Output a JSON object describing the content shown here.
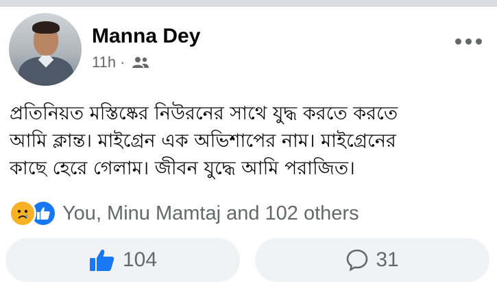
{
  "post": {
    "author": "Manna Dey",
    "time": "11h",
    "separator": "·",
    "audience_icon": "friends-icon",
    "menu_icon": "more-options-icon",
    "text_lines": [
      "প্রতিনিয়ত মস্তিষ্কের নিউরনের সাথে যুদ্ধ  করতে করতে",
      "আমি ক্লান্ত। মাইগ্রেন এক অভিশাপের নাম। মাইগ্রেনের",
      "কাছে হেরে গেলাম। জীবন যুদ্ধে আমি পরাজিত।"
    ]
  },
  "reactions": {
    "icons": [
      "sad-reaction-icon",
      "like-reaction-icon"
    ],
    "summary": "You, Minu Mamtaj and 102 others"
  },
  "actions": {
    "like_count": "104",
    "comment_count": "31"
  },
  "colors": {
    "brand_blue": "#1877f2",
    "secondary_text": "#65676b",
    "pill_bg": "#f0f2f5",
    "sad_yellow": "#f7b125"
  }
}
